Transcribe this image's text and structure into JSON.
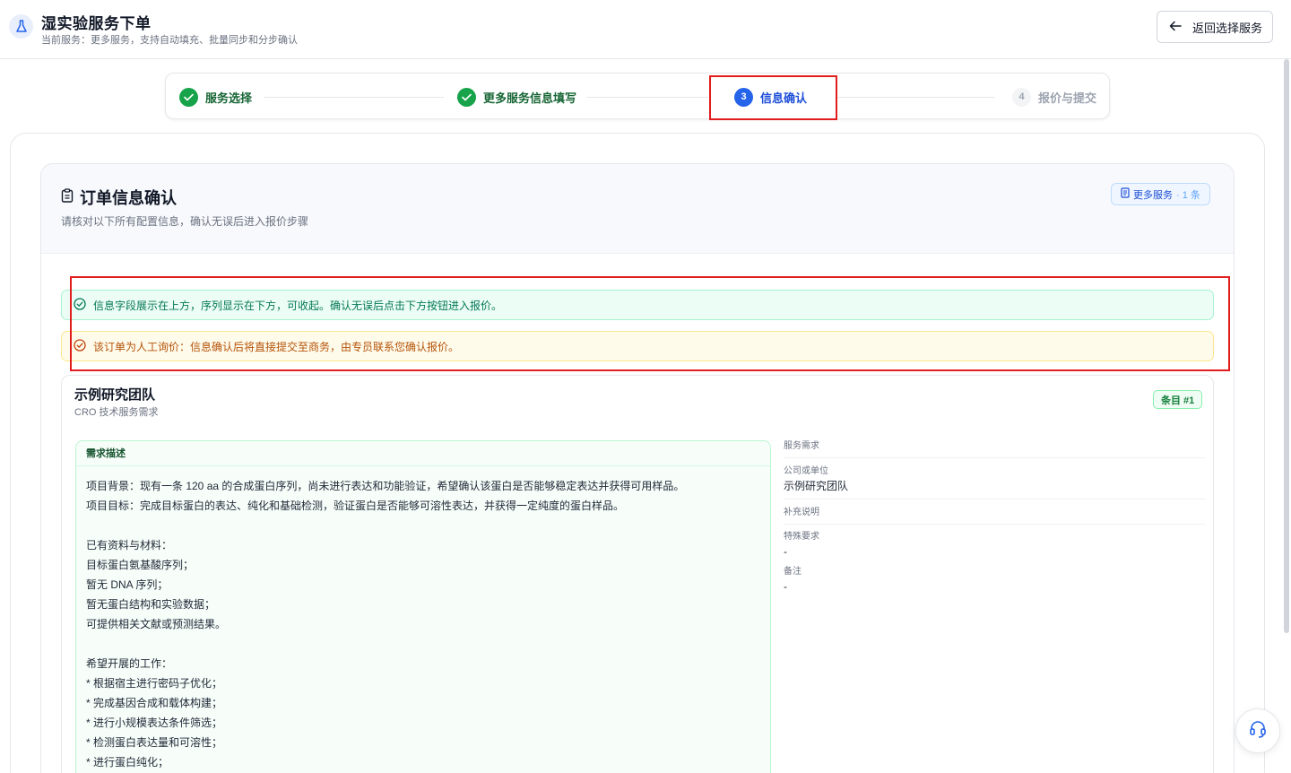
{
  "header": {
    "title": "湿实验服务下单",
    "subtitle": "当前服务：更多服务，支持自动填充、批量同步和分步确认",
    "back_label": "返回选择服务"
  },
  "steps": [
    {
      "label": "服务选择",
      "state": "done",
      "number": ""
    },
    {
      "label": "更多服务信息填写",
      "state": "done",
      "number": ""
    },
    {
      "label": "信息确认",
      "state": "active",
      "number": "3"
    },
    {
      "label": "报价与提交",
      "state": "todo",
      "number": "4"
    }
  ],
  "order": {
    "title": "订单信息确认",
    "subtitle": "请核对以下所有配置信息，确认无误后进入报价步骤",
    "service_badge": "更多服务",
    "service_count": "· 1 条"
  },
  "alerts": {
    "info": "信息字段展示在上方，序列显示在下方，可收起。确认无误后点击下方按钮进入报价。",
    "warning": "该订单为人工询价：信息确认后将直接提交至商务，由专员联系您确认报价。"
  },
  "team": {
    "name": "示例研究团队",
    "type": "CRO 技术服务需求",
    "item_badge": "条目 #1",
    "requirement_title": "需求描述",
    "requirement_lines": [
      "项目背景：现有一条 120 aa 的合成蛋白序列，尚未进行表达和功能验证，希望确认该蛋白是否能够稳定表达并获得可用样品。",
      "项目目标：完成目标蛋白的表达、纯化和基础检测，验证蛋白是否能够可溶性表达，并获得一定纯度的蛋白样品。",
      "",
      "已有资料与材料：",
      "目标蛋白氨基酸序列；",
      "暂无 DNA 序列；",
      "暂无蛋白结构和实验数据；",
      "可提供相关文献或预测结果。",
      "",
      "希望开展的工作：",
      "* 根据宿主进行密码子优化；",
      "* 完成基因合成和载体构建；",
      "* 进行小规模表达条件筛选；",
      "* 检测蛋白表达量和可溶性；",
      "* 进行蛋白纯化；"
    ],
    "side_fields": [
      {
        "label": "服务需求",
        "value": ""
      },
      {
        "label": "公司或单位",
        "value": "示例研究团队"
      },
      {
        "label": "补充说明",
        "value": ""
      },
      {
        "label": "特殊要求",
        "value": "-"
      },
      {
        "label": "备注",
        "value": "-"
      }
    ]
  },
  "colors": {
    "primary": "#2563eb",
    "success": "#16a34a",
    "warning": "#b45309",
    "highlight": "#e11d1d"
  },
  "icons": {
    "app": "flask-icon",
    "back": "arrow-left-icon",
    "order": "clipboard-icon",
    "check": "check-circle-icon",
    "support": "headset-icon"
  }
}
